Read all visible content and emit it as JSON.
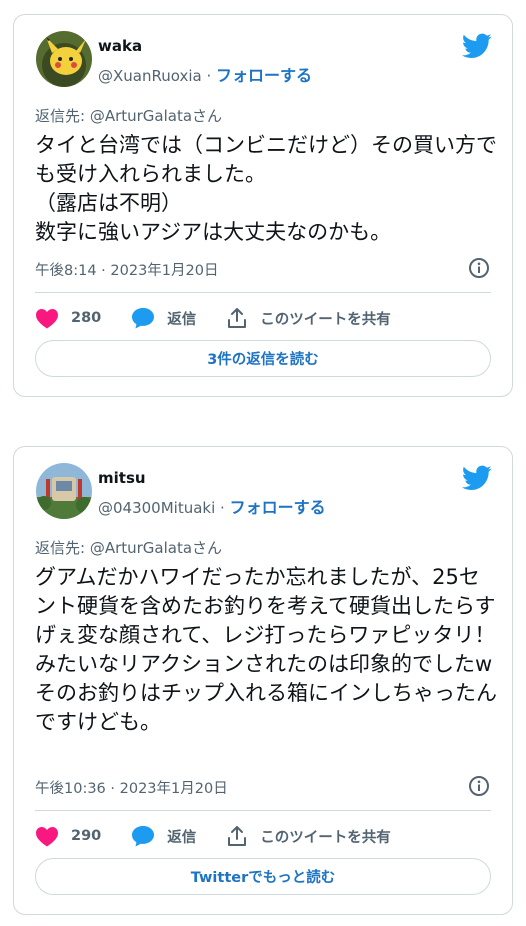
{
  "tweets": [
    {
      "name": "waka",
      "handle": "@XuanRuoxia",
      "separator": "·",
      "follow_label": "フォローする",
      "reply_to": "返信先: @ArturGalataさん",
      "text": "タイと台湾では（コンビニだけど）その買い方でも受け入れられました。\n（露店は不明）\n数字に強いアジアは大丈夫なのかも。",
      "timestamp": "午後8:14 · 2023年1月20日",
      "likes": "280",
      "reply_label": "返信",
      "share_label": "このツイートを共有",
      "cta_label": "3件の返信を読む"
    },
    {
      "name": "mitsu",
      "handle": "@04300Mituaki",
      "separator": "·",
      "follow_label": "フォローする",
      "reply_to": "返信先: @ArturGalataさん",
      "text": "グアムだかハワイだったか忘れましたが、25セント硬貨を含めたお釣りを考えて硬貨出したらすげぇ変な顔されて、レジ打ったらワァピッタリ！みたいなリアクションされたのは印象的でしたw\nそのお釣りはチップ入れる箱にインしちゃったんですけども。",
      "timestamp": "午後10:36 · 2023年1月20日",
      "likes": "290",
      "reply_label": "返信",
      "share_label": "このツイートを共有",
      "cta_label": "Twitterでもっと読む"
    }
  ],
  "colors": {
    "twitter_blue": "#1d9bf0",
    "link_blue": "#1d73c4",
    "heart_pink": "#f91880",
    "secondary_text": "#536471",
    "border": "#cfd9de"
  },
  "icons": {
    "bird": "twitter-bird-icon",
    "info": "info-icon",
    "like": "heart-icon",
    "reply": "reply-bubble-icon",
    "share": "share-upload-icon"
  }
}
